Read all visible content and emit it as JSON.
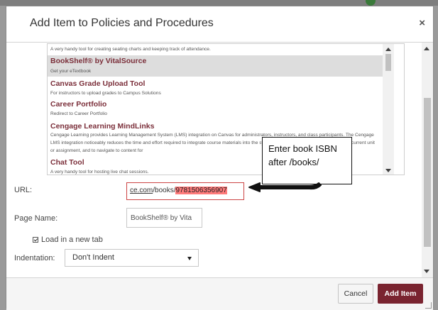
{
  "dialog": {
    "title": "Add Item to Policies and Procedures",
    "close_label": "×"
  },
  "tools": [
    {
      "title": "",
      "desc": "A very handy tool for creating seating charts and keeping track of attendance.",
      "selected": false
    },
    {
      "title": "BookShelf® by VitalSource",
      "desc": "Get your eTextbook",
      "selected": true
    },
    {
      "title": "Canvas Grade Upload Tool",
      "desc": "For instructors to upload grades to Campus Solutions",
      "selected": false
    },
    {
      "title": "Career Portfolio",
      "desc": "Redirect to Career Portfolio",
      "selected": false
    },
    {
      "title": "Cengage Learning MindLinks",
      "desc": "Cengage Learning provides Learning Management System (LMS) integration on Canvas for administrators, instructors, and class participants. The Cengage LMS integration noticeably reduces the time and effort required to integrate course materials into the system, find the right set of materials for the current unit or assignment, and to navigate to content for",
      "selected": false
    },
    {
      "title": "Chat Tool",
      "desc": "A very handy tool for hosting live chat sessions.",
      "selected": false
    }
  ],
  "form": {
    "url_label": "URL:",
    "url_prefix": "ce.com",
    "url_mid": "/books/",
    "url_isbn": "9781506356907",
    "page_name_label": "Page Name:",
    "page_name_value": "BookShelf® by Vita",
    "load_new_tab_label": "Load in a new tab",
    "load_new_tab_checked": true,
    "indentation_label": "Indentation:",
    "indentation_value": "Don't Indent"
  },
  "footer": {
    "cancel_label": "Cancel",
    "add_label": "Add Item"
  },
  "callout": {
    "line1": "Enter book ISBN",
    "line2": "after /books/"
  },
  "colors": {
    "accent": "#7a2430",
    "tool_title": "#7b2f3a",
    "highlight": "#ff7b7b",
    "selected_row": "#dddddd"
  },
  "icons": {
    "close": "close-icon",
    "dropdown": "chevron-down-icon",
    "arrow": "arrow-left-icon"
  }
}
